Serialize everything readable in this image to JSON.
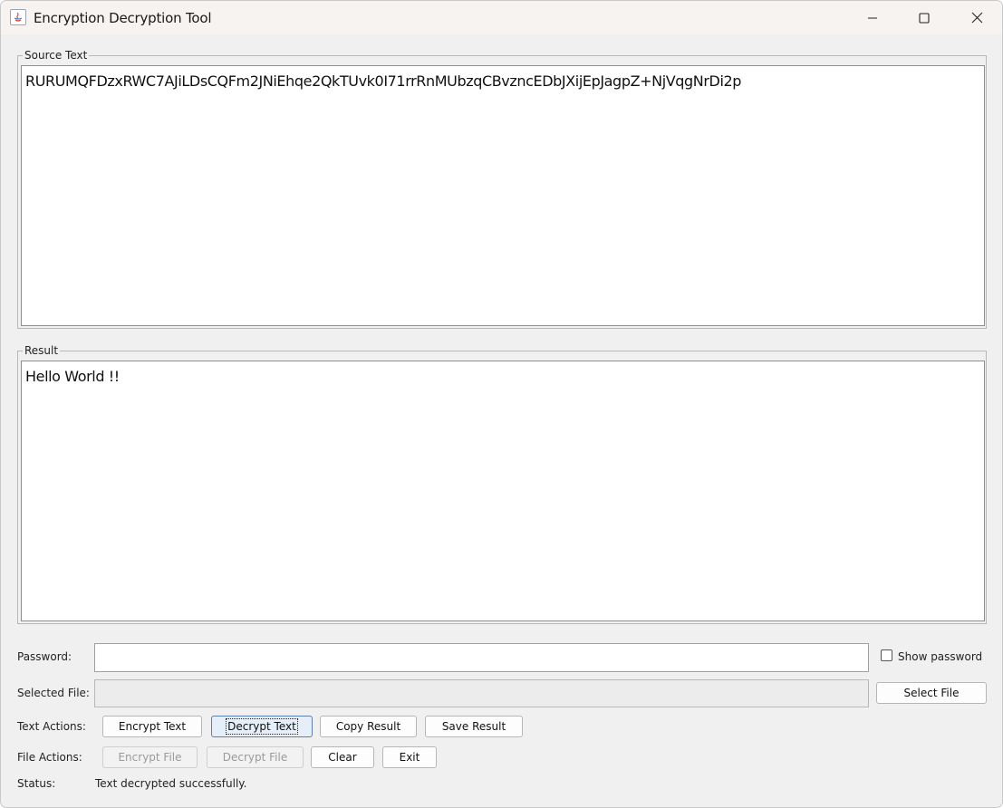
{
  "window": {
    "title": "Encryption Decryption Tool",
    "controls": {
      "minimize": "minimize-icon",
      "maximize": "maximize-icon",
      "close": "close-icon"
    }
  },
  "source": {
    "legend": "Source Text",
    "text": "RURUMQFDzxRWC7AJiLDsCQFm2JNiEhqe2QkTUvk0I71rrRnMUbzqCBvzncEDbJXijEpJagpZ+NjVqgNrDi2p"
  },
  "result": {
    "legend": "Result",
    "text": "Hello World !!"
  },
  "password": {
    "label": "Password:",
    "value": "",
    "show_label": "Show password",
    "show_checked": false
  },
  "file": {
    "label": "Selected File:",
    "value": "",
    "select_button": "Select File"
  },
  "text_actions": {
    "label": "Text Actions:",
    "encrypt": "Encrypt Text",
    "decrypt": "Decrypt Text",
    "copy": "Copy Result",
    "save": "Save Result"
  },
  "file_actions": {
    "label": "File Actions:",
    "encrypt": "Encrypt File",
    "decrypt": "Decrypt File",
    "clear": "Clear",
    "exit": "Exit"
  },
  "status": {
    "label": "Status:",
    "text": "Text decrypted successfully."
  }
}
